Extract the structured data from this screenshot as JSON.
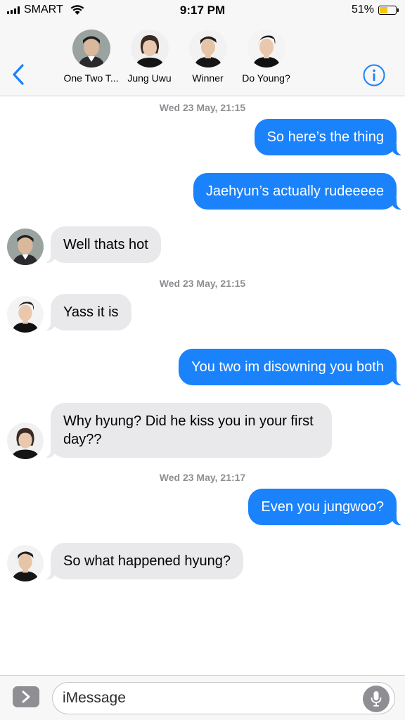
{
  "status_bar": {
    "carrier": "SMART",
    "time": "9:17 PM",
    "battery_text": "51%",
    "battery_level": 0.51,
    "battery_color": "#f5c518",
    "icons": [
      "signal-icon",
      "wifi-icon",
      "battery-icon"
    ]
  },
  "header": {
    "back_icon": "chevron-left-icon",
    "info_icon": "info-icon",
    "accent_color": "#1a82fb",
    "contacts": [
      {
        "name": "One Two T..."
      },
      {
        "name": "Jung Uwu"
      },
      {
        "name": "Winner"
      },
      {
        "name": "Do Young?"
      }
    ]
  },
  "conversation": {
    "timestamps": [
      "Wed 23 May, 21:15",
      "Wed 23 May, 21:15",
      "Wed 23 May, 21:17"
    ],
    "messages": [
      {
        "direction": "outgoing",
        "text": "So here’s the thing"
      },
      {
        "direction": "outgoing",
        "text": "Jaehyun’s actually rudeeeee"
      },
      {
        "direction": "incoming",
        "text": "Well thats hot"
      },
      {
        "direction": "incoming",
        "text": "Yass it is"
      },
      {
        "direction": "outgoing",
        "text": "You two im disowning you both"
      },
      {
        "direction": "incoming",
        "text": "Why hyung? Did he kiss you in your first day??"
      },
      {
        "direction": "outgoing",
        "text": "Even you jungwoo?"
      },
      {
        "direction": "incoming",
        "text": "So what happened hyung?"
      }
    ],
    "outgoing_color": "#1a82fb",
    "incoming_color": "#e9e9eb"
  },
  "input_bar": {
    "placeholder": "iMessage",
    "app_drawer_icon": "chevron-right-icon",
    "mic_icon": "microphone-icon"
  }
}
